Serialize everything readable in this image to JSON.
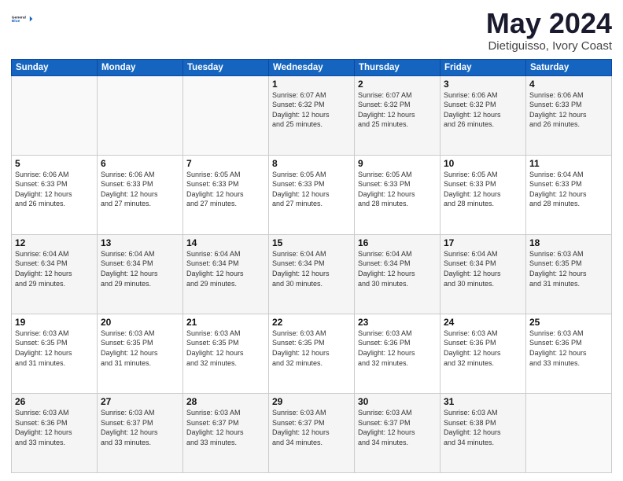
{
  "header": {
    "logo_line1": "General",
    "logo_line2": "Blue",
    "title": "May 2024",
    "subtitle": "Dietiguisso, Ivory Coast"
  },
  "weekdays": [
    "Sunday",
    "Monday",
    "Tuesday",
    "Wednesday",
    "Thursday",
    "Friday",
    "Saturday"
  ],
  "weeks": [
    [
      {
        "day": "",
        "info": ""
      },
      {
        "day": "",
        "info": ""
      },
      {
        "day": "",
        "info": ""
      },
      {
        "day": "1",
        "info": "Sunrise: 6:07 AM\nSunset: 6:32 PM\nDaylight: 12 hours\nand 25 minutes."
      },
      {
        "day": "2",
        "info": "Sunrise: 6:07 AM\nSunset: 6:32 PM\nDaylight: 12 hours\nand 25 minutes."
      },
      {
        "day": "3",
        "info": "Sunrise: 6:06 AM\nSunset: 6:32 PM\nDaylight: 12 hours\nand 26 minutes."
      },
      {
        "day": "4",
        "info": "Sunrise: 6:06 AM\nSunset: 6:33 PM\nDaylight: 12 hours\nand 26 minutes."
      }
    ],
    [
      {
        "day": "5",
        "info": "Sunrise: 6:06 AM\nSunset: 6:33 PM\nDaylight: 12 hours\nand 26 minutes."
      },
      {
        "day": "6",
        "info": "Sunrise: 6:06 AM\nSunset: 6:33 PM\nDaylight: 12 hours\nand 27 minutes."
      },
      {
        "day": "7",
        "info": "Sunrise: 6:05 AM\nSunset: 6:33 PM\nDaylight: 12 hours\nand 27 minutes."
      },
      {
        "day": "8",
        "info": "Sunrise: 6:05 AM\nSunset: 6:33 PM\nDaylight: 12 hours\nand 27 minutes."
      },
      {
        "day": "9",
        "info": "Sunrise: 6:05 AM\nSunset: 6:33 PM\nDaylight: 12 hours\nand 28 minutes."
      },
      {
        "day": "10",
        "info": "Sunrise: 6:05 AM\nSunset: 6:33 PM\nDaylight: 12 hours\nand 28 minutes."
      },
      {
        "day": "11",
        "info": "Sunrise: 6:04 AM\nSunset: 6:33 PM\nDaylight: 12 hours\nand 28 minutes."
      }
    ],
    [
      {
        "day": "12",
        "info": "Sunrise: 6:04 AM\nSunset: 6:34 PM\nDaylight: 12 hours\nand 29 minutes."
      },
      {
        "day": "13",
        "info": "Sunrise: 6:04 AM\nSunset: 6:34 PM\nDaylight: 12 hours\nand 29 minutes."
      },
      {
        "day": "14",
        "info": "Sunrise: 6:04 AM\nSunset: 6:34 PM\nDaylight: 12 hours\nand 29 minutes."
      },
      {
        "day": "15",
        "info": "Sunrise: 6:04 AM\nSunset: 6:34 PM\nDaylight: 12 hours\nand 30 minutes."
      },
      {
        "day": "16",
        "info": "Sunrise: 6:04 AM\nSunset: 6:34 PM\nDaylight: 12 hours\nand 30 minutes."
      },
      {
        "day": "17",
        "info": "Sunrise: 6:04 AM\nSunset: 6:34 PM\nDaylight: 12 hours\nand 30 minutes."
      },
      {
        "day": "18",
        "info": "Sunrise: 6:03 AM\nSunset: 6:35 PM\nDaylight: 12 hours\nand 31 minutes."
      }
    ],
    [
      {
        "day": "19",
        "info": "Sunrise: 6:03 AM\nSunset: 6:35 PM\nDaylight: 12 hours\nand 31 minutes."
      },
      {
        "day": "20",
        "info": "Sunrise: 6:03 AM\nSunset: 6:35 PM\nDaylight: 12 hours\nand 31 minutes."
      },
      {
        "day": "21",
        "info": "Sunrise: 6:03 AM\nSunset: 6:35 PM\nDaylight: 12 hours\nand 32 minutes."
      },
      {
        "day": "22",
        "info": "Sunrise: 6:03 AM\nSunset: 6:35 PM\nDaylight: 12 hours\nand 32 minutes."
      },
      {
        "day": "23",
        "info": "Sunrise: 6:03 AM\nSunset: 6:36 PM\nDaylight: 12 hours\nand 32 minutes."
      },
      {
        "day": "24",
        "info": "Sunrise: 6:03 AM\nSunset: 6:36 PM\nDaylight: 12 hours\nand 32 minutes."
      },
      {
        "day": "25",
        "info": "Sunrise: 6:03 AM\nSunset: 6:36 PM\nDaylight: 12 hours\nand 33 minutes."
      }
    ],
    [
      {
        "day": "26",
        "info": "Sunrise: 6:03 AM\nSunset: 6:36 PM\nDaylight: 12 hours\nand 33 minutes."
      },
      {
        "day": "27",
        "info": "Sunrise: 6:03 AM\nSunset: 6:37 PM\nDaylight: 12 hours\nand 33 minutes."
      },
      {
        "day": "28",
        "info": "Sunrise: 6:03 AM\nSunset: 6:37 PM\nDaylight: 12 hours\nand 33 minutes."
      },
      {
        "day": "29",
        "info": "Sunrise: 6:03 AM\nSunset: 6:37 PM\nDaylight: 12 hours\nand 34 minutes."
      },
      {
        "day": "30",
        "info": "Sunrise: 6:03 AM\nSunset: 6:37 PM\nDaylight: 12 hours\nand 34 minutes."
      },
      {
        "day": "31",
        "info": "Sunrise: 6:03 AM\nSunset: 6:38 PM\nDaylight: 12 hours\nand 34 minutes."
      },
      {
        "day": "",
        "info": ""
      }
    ]
  ]
}
